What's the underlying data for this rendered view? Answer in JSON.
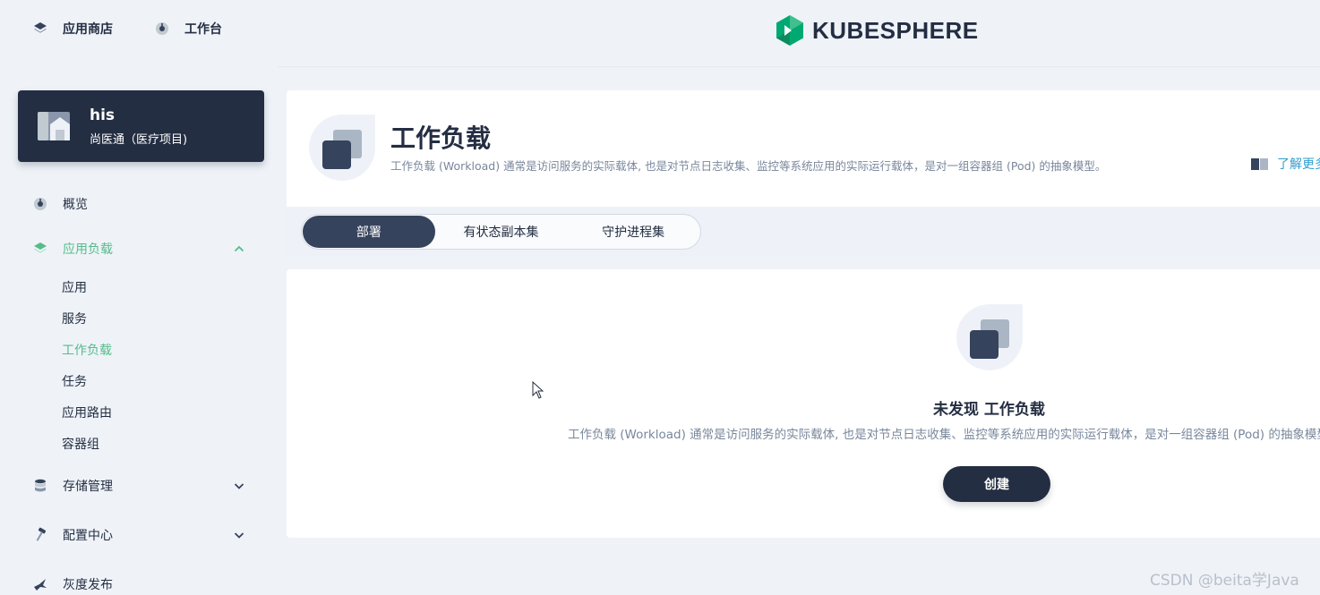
{
  "topbar": {
    "nav": [
      {
        "label": "应用商店",
        "icon": "layers-icon"
      },
      {
        "label": "工作台",
        "icon": "dashboard-icon"
      }
    ],
    "logo_text": "KUBESPHERE"
  },
  "project": {
    "name": "his",
    "description": "尚医通（医疗项目)"
  },
  "sidebar": {
    "items": [
      {
        "label": "概览",
        "icon": "dashboard-icon",
        "expanded": false
      },
      {
        "label": "应用负载",
        "icon": "layers-icon",
        "expanded": true,
        "active": true,
        "children": [
          {
            "label": "应用"
          },
          {
            "label": "服务"
          },
          {
            "label": "工作负载",
            "active": true
          },
          {
            "label": "任务"
          },
          {
            "label": "应用路由"
          },
          {
            "label": "容器组"
          }
        ]
      },
      {
        "label": "存储管理",
        "icon": "database-icon",
        "expanded": false
      },
      {
        "label": "配置中心",
        "icon": "hammer-icon",
        "expanded": false
      },
      {
        "label": "灰度发布",
        "icon": "bird-icon",
        "expanded": false
      }
    ]
  },
  "banner": {
    "title": "工作负载",
    "description": "工作负载 (Workload) 通常是访问服务的实际载体, 也是对节点日志收集、监控等系统应用的实际运行载体，是对一组容器组 (Pod) 的抽象模型。",
    "learn_more": "了解更多"
  },
  "tabs": [
    {
      "label": "部署",
      "active": true
    },
    {
      "label": "有状态副本集",
      "active": false
    },
    {
      "label": "守护进程集",
      "active": false
    }
  ],
  "empty_state": {
    "title": "未发现 工作负载",
    "description": "工作负载 (Workload) 通常是访问服务的实际载体, 也是对节点日志收集、监控等系统应用的实际运行载体，是对一组容器组 (Pod) 的抽象模型。",
    "create_label": "创建"
  },
  "watermark": "CSDN @beita学Java",
  "colors": {
    "accent_green": "#55bc8a",
    "dark": "#242e42",
    "link_blue": "#329dce",
    "muted_text": "#79879c",
    "background": "#eff3f8"
  }
}
